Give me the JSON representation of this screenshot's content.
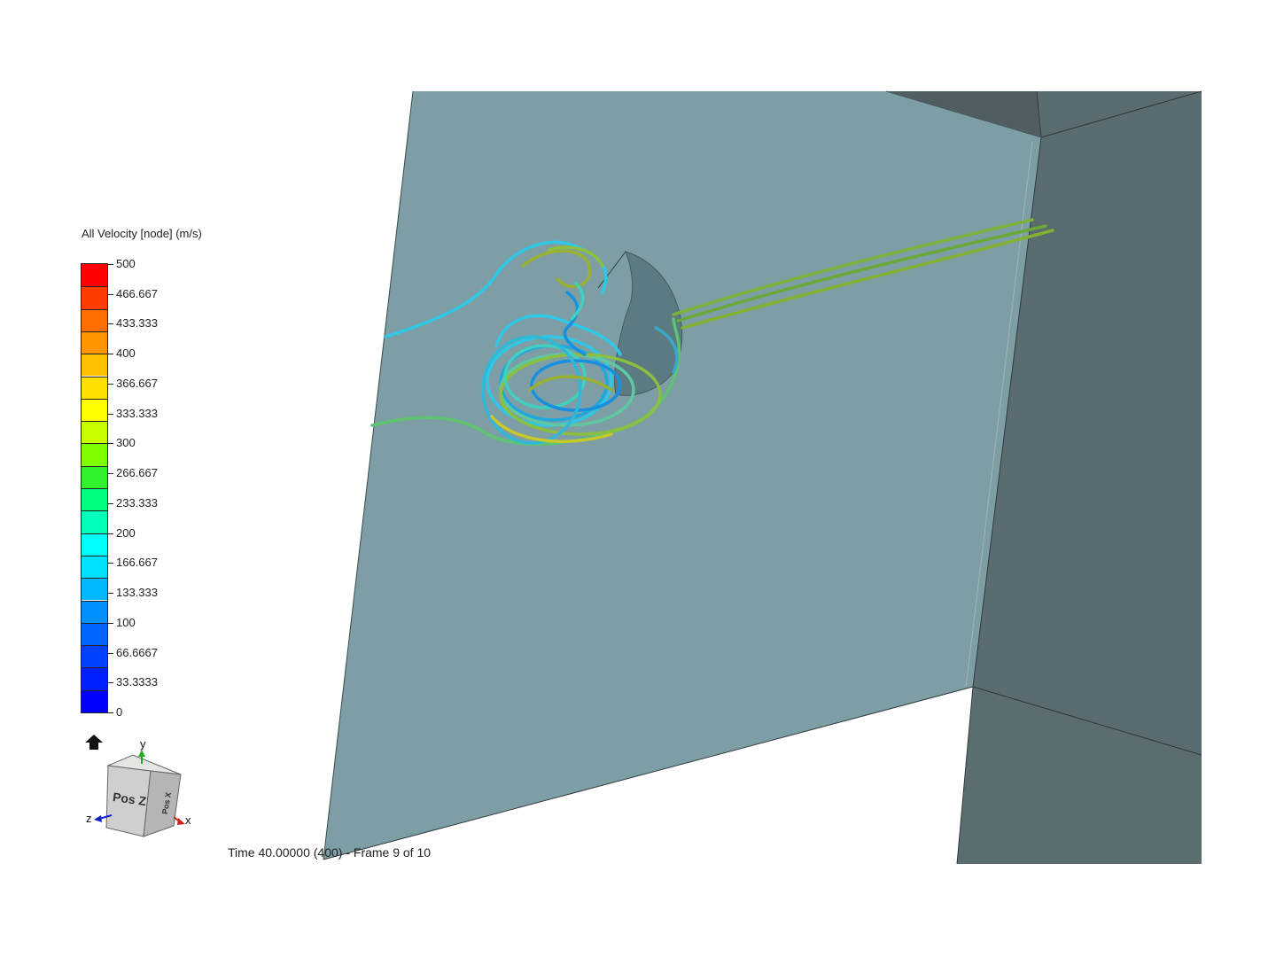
{
  "legend": {
    "title": "All Velocity [node] (m/s)",
    "ticks": [
      "500",
      "466.667",
      "433.333",
      "400",
      "366.667",
      "333.333",
      "300",
      "266.667",
      "233.333",
      "200",
      "166.667",
      "133.333",
      "100",
      "66.6667",
      "33.3333",
      "0"
    ],
    "colors": [
      "#ff0000",
      "#ff3c00",
      "#ff6e00",
      "#ff9600",
      "#ffc000",
      "#ffe000",
      "#ffff00",
      "#c8ff00",
      "#80ff00",
      "#30f030",
      "#00ff80",
      "#00ffb8",
      "#00ffff",
      "#00e0ff",
      "#00b8ff",
      "#0090ff",
      "#0064ff",
      "#0040ff",
      "#0020ff",
      "#0000ff"
    ]
  },
  "status": {
    "time": "Time 40.00000 (400) - Frame 9 of 10"
  },
  "orientation": {
    "face_front": "Pos Z",
    "face_right": "Pos X",
    "axis_y": "y",
    "axis_z": "z",
    "axis_x": "x",
    "home_icon": "home-icon"
  },
  "scene": {
    "domain_color": "#6e8f97",
    "wall_color": "#5b6d70",
    "streamline_colors": [
      "#2ec8e6",
      "#40d0c0",
      "#7fc040",
      "#9ab030",
      "#1890e0",
      "#c8c828"
    ]
  }
}
